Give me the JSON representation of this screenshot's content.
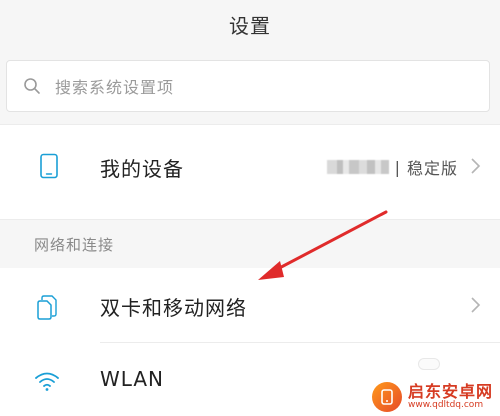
{
  "header": {
    "title": "设置"
  },
  "search": {
    "placeholder": "搜索系统设置项",
    "icon": "search-icon"
  },
  "device_row": {
    "label": "我的设备",
    "version_label": "稳定版",
    "separator": "|",
    "icon": "phone-icon"
  },
  "section": {
    "title": "网络和连接"
  },
  "rows": [
    {
      "label": "双卡和移动网络",
      "icon": "dual-sim-icon"
    },
    {
      "label": "WLAN",
      "icon": "wifi-icon"
    }
  ],
  "annotation": {
    "color": "#e02b2b",
    "shape": "arrow"
  },
  "watermark": {
    "name": "启东安卓网",
    "url": "www.qdltdq.com"
  },
  "colors": {
    "accent": "#1a9fd6",
    "background": "#f6f6f6",
    "card": "#ffffff",
    "annotation": "#e02b2b"
  }
}
